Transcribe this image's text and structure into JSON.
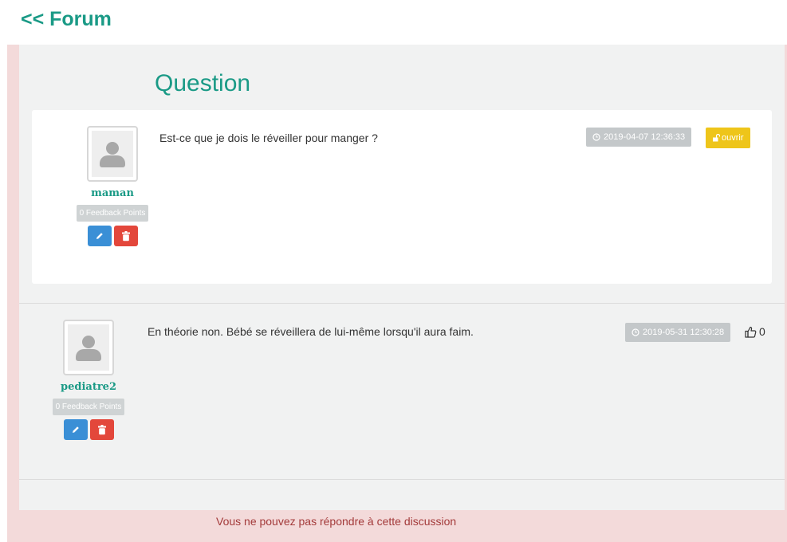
{
  "nav": {
    "back_label": "<< Forum"
  },
  "title": "Question",
  "question": {
    "author": "maman",
    "points": "0 Feedback Points",
    "text": "Est-ce que je dois le réveiller pour manger ?",
    "date": "2019-04-07 12:36:33",
    "open_label": "ouvrir"
  },
  "answers": [
    {
      "author": "pediatre2",
      "points": "0 Feedback Points",
      "text": "En théorie non. Bébé se réveillera de lui-même lorsqu'il aura faim.",
      "date": "2019-05-31 12:30:28",
      "likes": "0"
    }
  ],
  "notice": "Vous ne pouvez pas répondre à cette discussion",
  "icons": {
    "avatar": "user-placeholder-icon",
    "edit": "pencil-icon",
    "delete": "trash-icon",
    "clock": "clock-icon",
    "unlock": "unlock-icon",
    "like": "thumbs-up-icon"
  },
  "colors": {
    "accent": "#1a9a86",
    "edit": "#3a8fd6",
    "delete": "#e3473b",
    "open": "#eec51a",
    "badge": "#c4c8ca",
    "outer_bg": "#f3dada",
    "notice": "#a33a3a"
  }
}
